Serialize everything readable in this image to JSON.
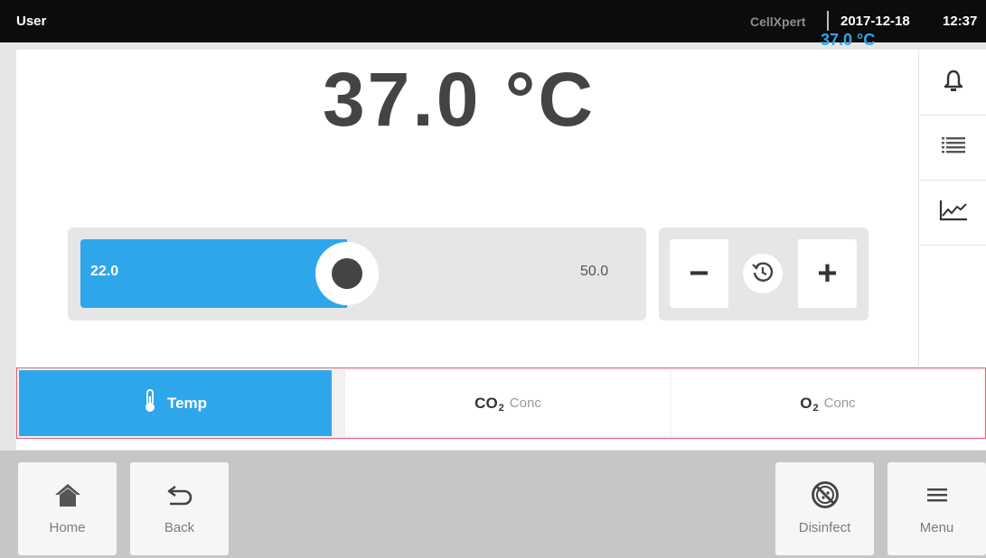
{
  "topbar": {
    "user": "User",
    "device": "CellXpert",
    "date": "2017-12-18",
    "time": "12:37"
  },
  "reading": {
    "value": "37.0 °C",
    "setpoint": "37.0 °C"
  },
  "side_icons": [
    "bell-icon",
    "list-icon",
    "chart-icon"
  ],
  "slider": {
    "min_label": "22.0",
    "max_label": "50.0",
    "min": 22.0,
    "max": 50.0,
    "current": 37.0
  },
  "stepper": {
    "minus_label": "−",
    "plus_label": "+",
    "reset_icon": "history-icon"
  },
  "tabs": {
    "temp": {
      "label": "Temp",
      "icon": "thermometer-icon",
      "active": true
    },
    "co2": {
      "main": "CO",
      "sub": "2",
      "suffix": "Conc",
      "active": false
    },
    "o2": {
      "main": "O",
      "sub": "2",
      "suffix": "Conc",
      "active": false
    }
  },
  "nav": {
    "home": "Home",
    "back": "Back",
    "disinfect": "Disinfect",
    "menu": "Menu"
  },
  "colors": {
    "accent": "#2ea6ec",
    "topbar": "#0c0c0c",
    "highlight_border": "#e0607a"
  }
}
